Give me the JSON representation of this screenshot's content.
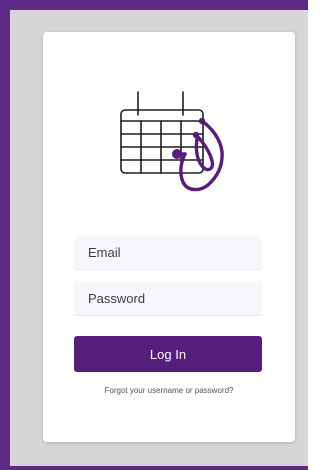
{
  "login": {
    "logo_icon": "calendar-stethoscope-icon",
    "email_placeholder": "Email",
    "password_placeholder": "Password",
    "login_label": "Log In",
    "forgot_link": "Forgot your username or password?"
  },
  "colors": {
    "brand_purple": "#541e7a",
    "frame_purple": "#5c2a84",
    "backdrop_gray": "#d6d5d8",
    "field_background": "#f6f7fb"
  }
}
